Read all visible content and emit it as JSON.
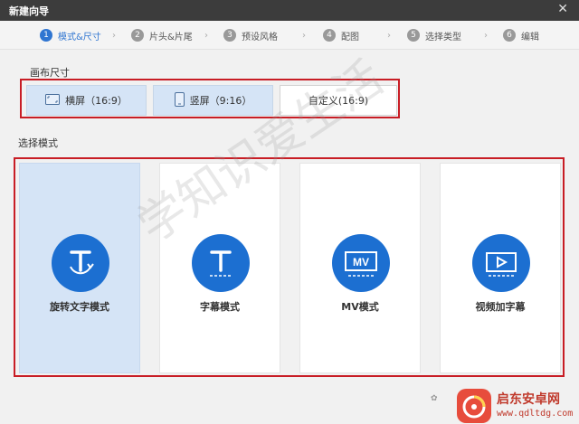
{
  "window": {
    "title": "新建向导",
    "close_glyph": "✕"
  },
  "steps": [
    {
      "num": "1",
      "label": "模式&尺寸",
      "active": true
    },
    {
      "num": "2",
      "label": "片头&片尾",
      "active": false
    },
    {
      "num": "3",
      "label": "预设风格",
      "active": false
    },
    {
      "num": "4",
      "label": "配图",
      "active": false
    },
    {
      "num": "5",
      "label": "选择类型",
      "active": false
    },
    {
      "num": "6",
      "label": "编辑",
      "active": false
    }
  ],
  "step_separator": "›",
  "canvas": {
    "section_label": "画布尺寸",
    "options": [
      {
        "label": "横屏（16:9）",
        "icon": "landscape-icon"
      },
      {
        "label": "竖屏（9:16）",
        "icon": "portrait-icon"
      },
      {
        "label": "自定义(16:9)",
        "icon": ""
      }
    ]
  },
  "modes": {
    "section_label": "选择模式",
    "items": [
      {
        "label": "旋转文字模式",
        "icon": "rotate-text-icon",
        "selected": true
      },
      {
        "label": "字幕模式",
        "icon": "subtitle-text-icon",
        "selected": false
      },
      {
        "label": "MV模式",
        "icon": "mv-icon",
        "selected": false
      },
      {
        "label": "视频加字幕",
        "icon": "video-play-icon",
        "selected": false
      }
    ]
  },
  "watermark": {
    "diagonal_text": "学知识爱生活",
    "brand_name": "启东安卓网",
    "brand_url": "www.qdltdg.com",
    "wechat_glyph": "✿"
  },
  "colors": {
    "accent": "#1c6fd1",
    "highlight_border": "#c81d25",
    "selected_bg": "#d5e4f6"
  }
}
